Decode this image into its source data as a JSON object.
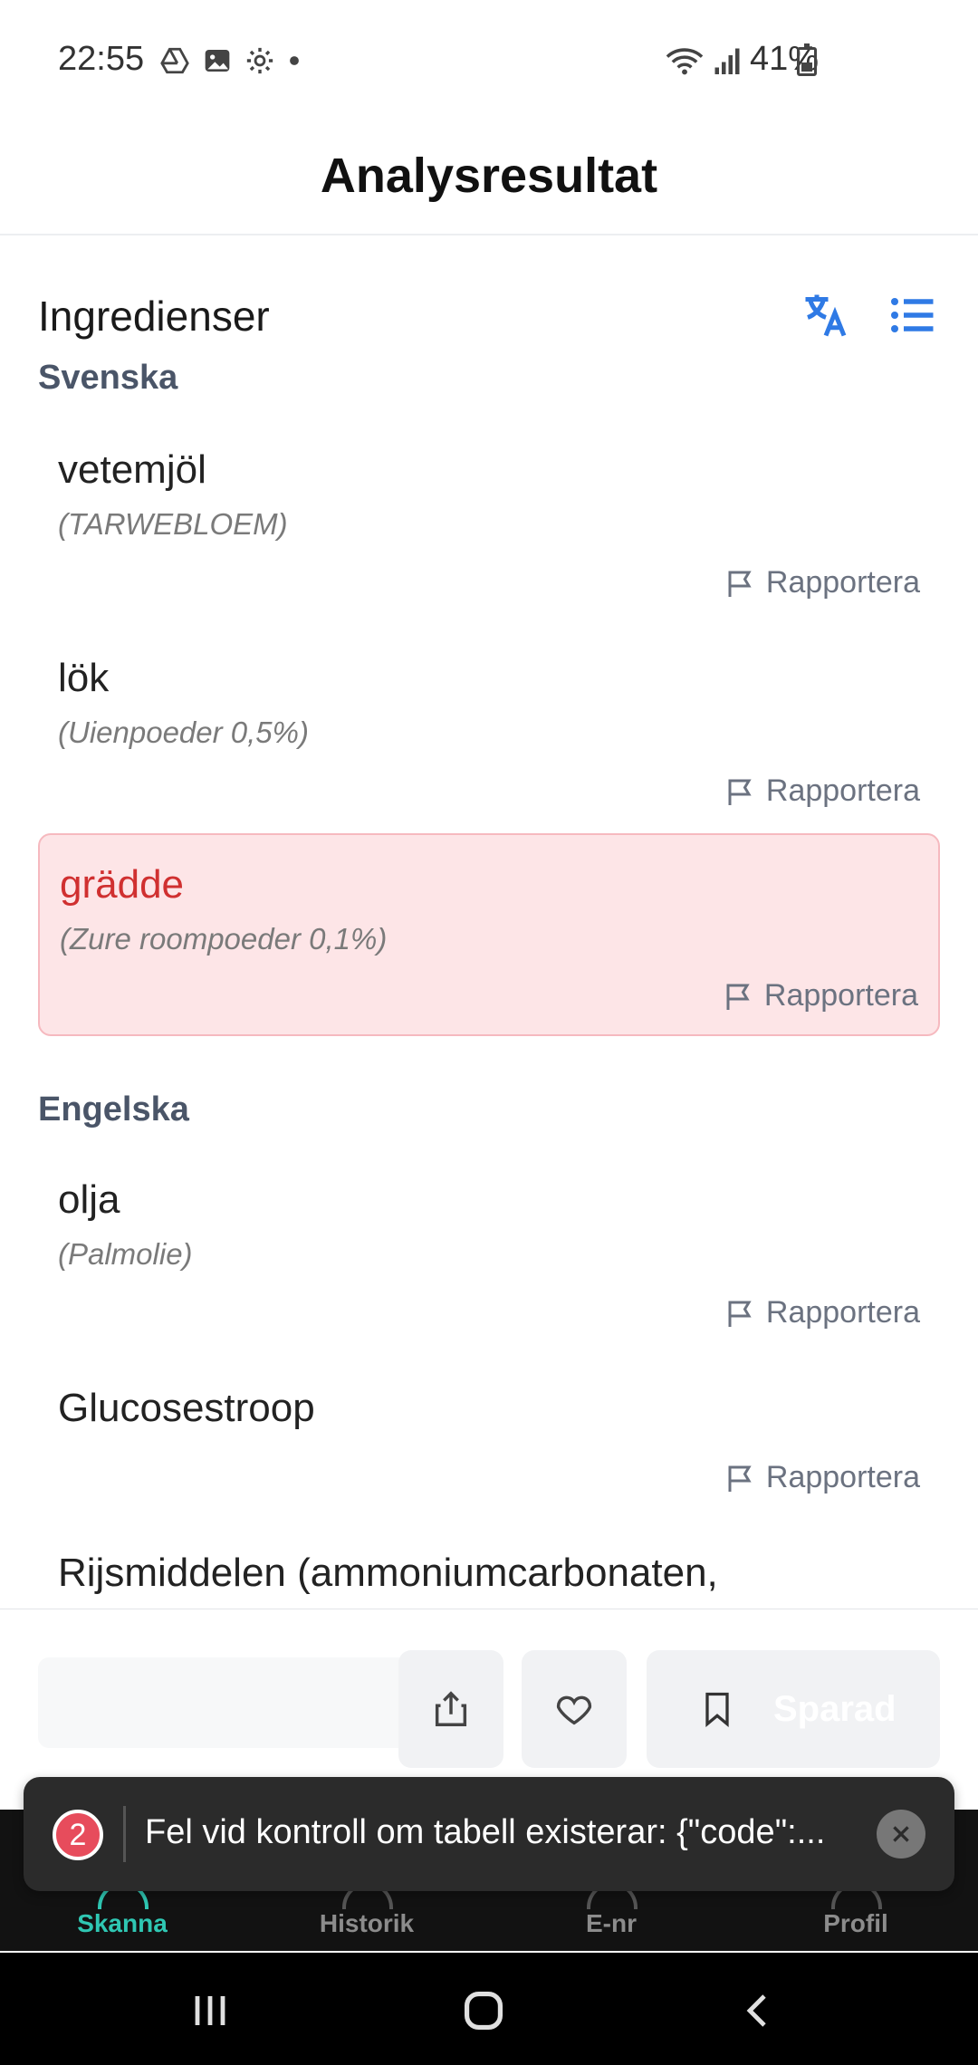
{
  "status_bar": {
    "time": "22:55",
    "battery": "41%",
    "left_icons": [
      "drive-icon",
      "image-icon",
      "settings-icon",
      "dot-icon"
    ],
    "right_icons": [
      "wifi-icon",
      "signal-icon",
      "battery-icon"
    ]
  },
  "header": {
    "title": "Analysresultat"
  },
  "ingredients_section": {
    "title": "Ingredienser",
    "accent_color": "#2f7ae5",
    "report_label": "Rapportera",
    "groups": [
      {
        "label": "Svenska",
        "items": [
          {
            "name": "vetemjöl",
            "original": "(TARWEBLOEM)"
          },
          {
            "name": "lök",
            "original": "(Uienpoeder 0,5%)"
          },
          {
            "name": "grädde",
            "original": "(Zure roompoeder 0,1%)",
            "highlight": true
          }
        ]
      },
      {
        "label": "Engelska",
        "items": [
          {
            "name": "olja",
            "original": "(Palmolie)"
          },
          {
            "name": "Glucosestroop"
          },
          {
            "name": "Rijsmiddelen (ammoniumcarbonaten,"
          }
        ]
      }
    ]
  },
  "action_bar": {
    "saved_label": "Sparad"
  },
  "bottom_nav": {
    "items": [
      {
        "label": "Skanna",
        "active": true
      },
      {
        "label": "Historik"
      },
      {
        "label": "E-nr"
      },
      {
        "label": "Profil"
      }
    ],
    "active_color": "#2fc7b3"
  },
  "toast": {
    "count": "2",
    "message": "Fel vid kontroll om tabell existerar: {\"code\":..."
  }
}
